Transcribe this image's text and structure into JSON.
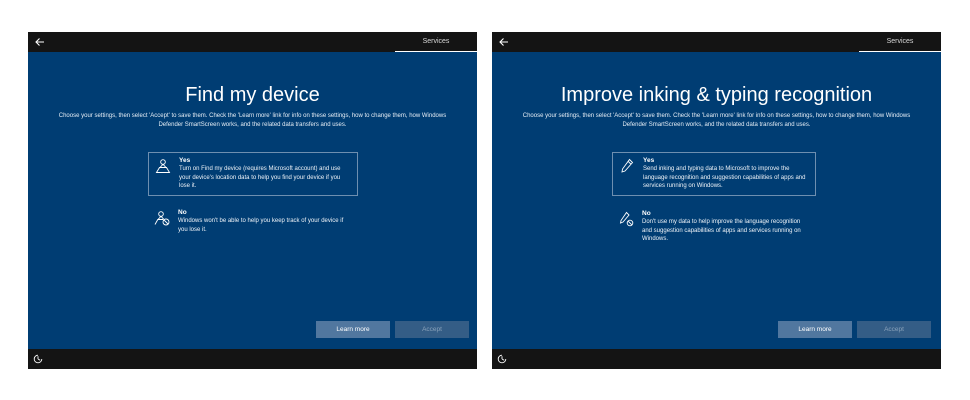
{
  "screens": [
    {
      "tab": "Services",
      "title": "Find my device",
      "description": "Choose your settings, then select 'Accept' to save them. Check the 'Learn more' link for info on these settings, how to change them, how Windows Defender SmartScreen works, and the related data transfers and uses.",
      "options": [
        {
          "label": "Yes",
          "text": "Turn on Find my device (requires Microsoft account) and use your device's location data to help you find your device if you lose it.",
          "icon": "location-person-icon",
          "selected": true
        },
        {
          "label": "No",
          "text": "Windows won't be able to help you keep track of your device if you lose it.",
          "icon": "location-person-off-icon",
          "selected": false
        }
      ],
      "learn_more_label": "Learn more",
      "accept_label": "Accept"
    },
    {
      "tab": "Services",
      "title": "Improve inking & typing recognition",
      "description": "Choose your settings, then select 'Accept' to save them. Check the 'Learn more' link for info on these settings, how to change them, how Windows Defender SmartScreen works, and the related data transfers and uses.",
      "options": [
        {
          "label": "Yes",
          "text": "Send inking and typing data to Microsoft to improve the language recognition and suggestion capabilities of apps and services running on Windows.",
          "icon": "pen-icon",
          "selected": true
        },
        {
          "label": "No",
          "text": "Don't use my data to help improve the language recognition and suggestion capabilities of apps and services running on Windows.",
          "icon": "pen-off-icon",
          "selected": false
        }
      ],
      "learn_more_label": "Learn more",
      "accept_label": "Accept"
    }
  ],
  "colors": {
    "background": "#003d73",
    "bar": "#141414",
    "learn_more_button": "#51779f",
    "accept_button_disabled": "#345d86"
  }
}
